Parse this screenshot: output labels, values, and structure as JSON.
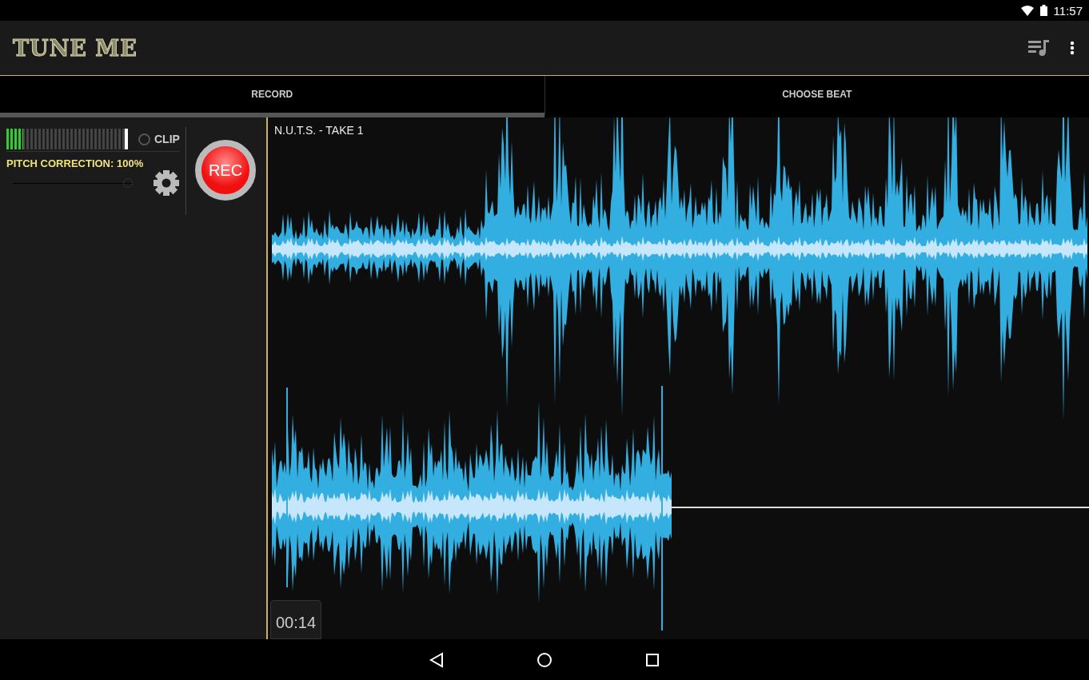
{
  "status_bar": {
    "time": "11:57"
  },
  "app_bar": {
    "title": "TUNE ME"
  },
  "tabs": [
    {
      "label": "RECORD",
      "selected": true
    },
    {
      "label": "CHOOSE BEAT",
      "selected": false
    }
  ],
  "controls": {
    "input_meter": {
      "level": 0.14
    },
    "clip": {
      "label": "CLIP",
      "on": false
    },
    "pitch_correction": {
      "label": "PITCH CORRECTION: 100%",
      "level": 1
    },
    "record_button": {
      "label": "REC"
    }
  },
  "track": {
    "title": "N.U.T.S. - TAKE 1",
    "time": "00:14"
  }
}
